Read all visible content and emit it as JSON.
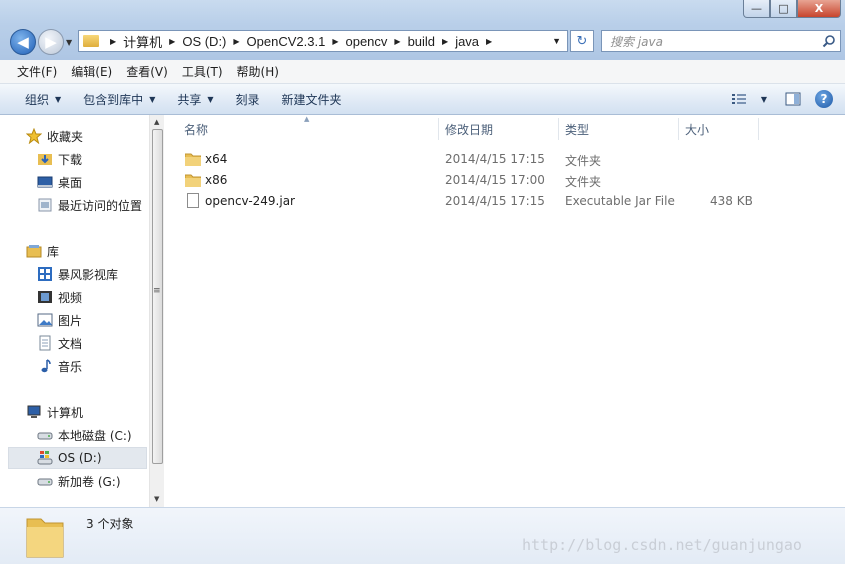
{
  "window": {
    "minimize": "—",
    "maximize": "□",
    "close": "X"
  },
  "address": {
    "breadcrumbs": [
      "计算机",
      "OS (D:)",
      "OpenCV2.3.1",
      "opencv",
      "build",
      "java"
    ],
    "search_placeholder": "搜索 java"
  },
  "menu": [
    "文件(F)",
    "编辑(E)",
    "查看(V)",
    "工具(T)",
    "帮助(H)"
  ],
  "commands": {
    "organize": "组织",
    "include_library": "包含到库中",
    "share": "共享",
    "burn": "刻录",
    "new_folder": "新建文件夹"
  },
  "nav": {
    "favorites": {
      "title": "收藏夹",
      "items": [
        "下载",
        "桌面",
        "最近访问的位置"
      ]
    },
    "libraries": {
      "title": "库",
      "items": [
        "暴风影视库",
        "视频",
        "图片",
        "文档",
        "音乐"
      ]
    },
    "computer": {
      "title": "计算机",
      "items": [
        "本地磁盘 (C:)",
        "OS (D:)",
        "新加卷 (G:)"
      ]
    }
  },
  "columns": {
    "name": "名称",
    "date": "修改日期",
    "type": "类型",
    "size": "大小"
  },
  "files": [
    {
      "name": "x64",
      "date": "2014/4/15 17:15",
      "type": "文件夹",
      "size": "",
      "icon": "folder-icon"
    },
    {
      "name": "x86",
      "date": "2014/4/15 17:00",
      "type": "文件夹",
      "size": "",
      "icon": "folder-icon"
    },
    {
      "name": "opencv-249.jar",
      "date": "2014/4/15 17:15",
      "type": "Executable Jar File",
      "size": "438 KB",
      "icon": "jar-file-icon"
    }
  ],
  "status": {
    "count": "3 个对象",
    "watermark": "http://blog.csdn.net/guanjungao"
  },
  "colors": {
    "accent": "#1f5fb7",
    "folder": "#e8be52",
    "selected": "#e3e8ee"
  }
}
